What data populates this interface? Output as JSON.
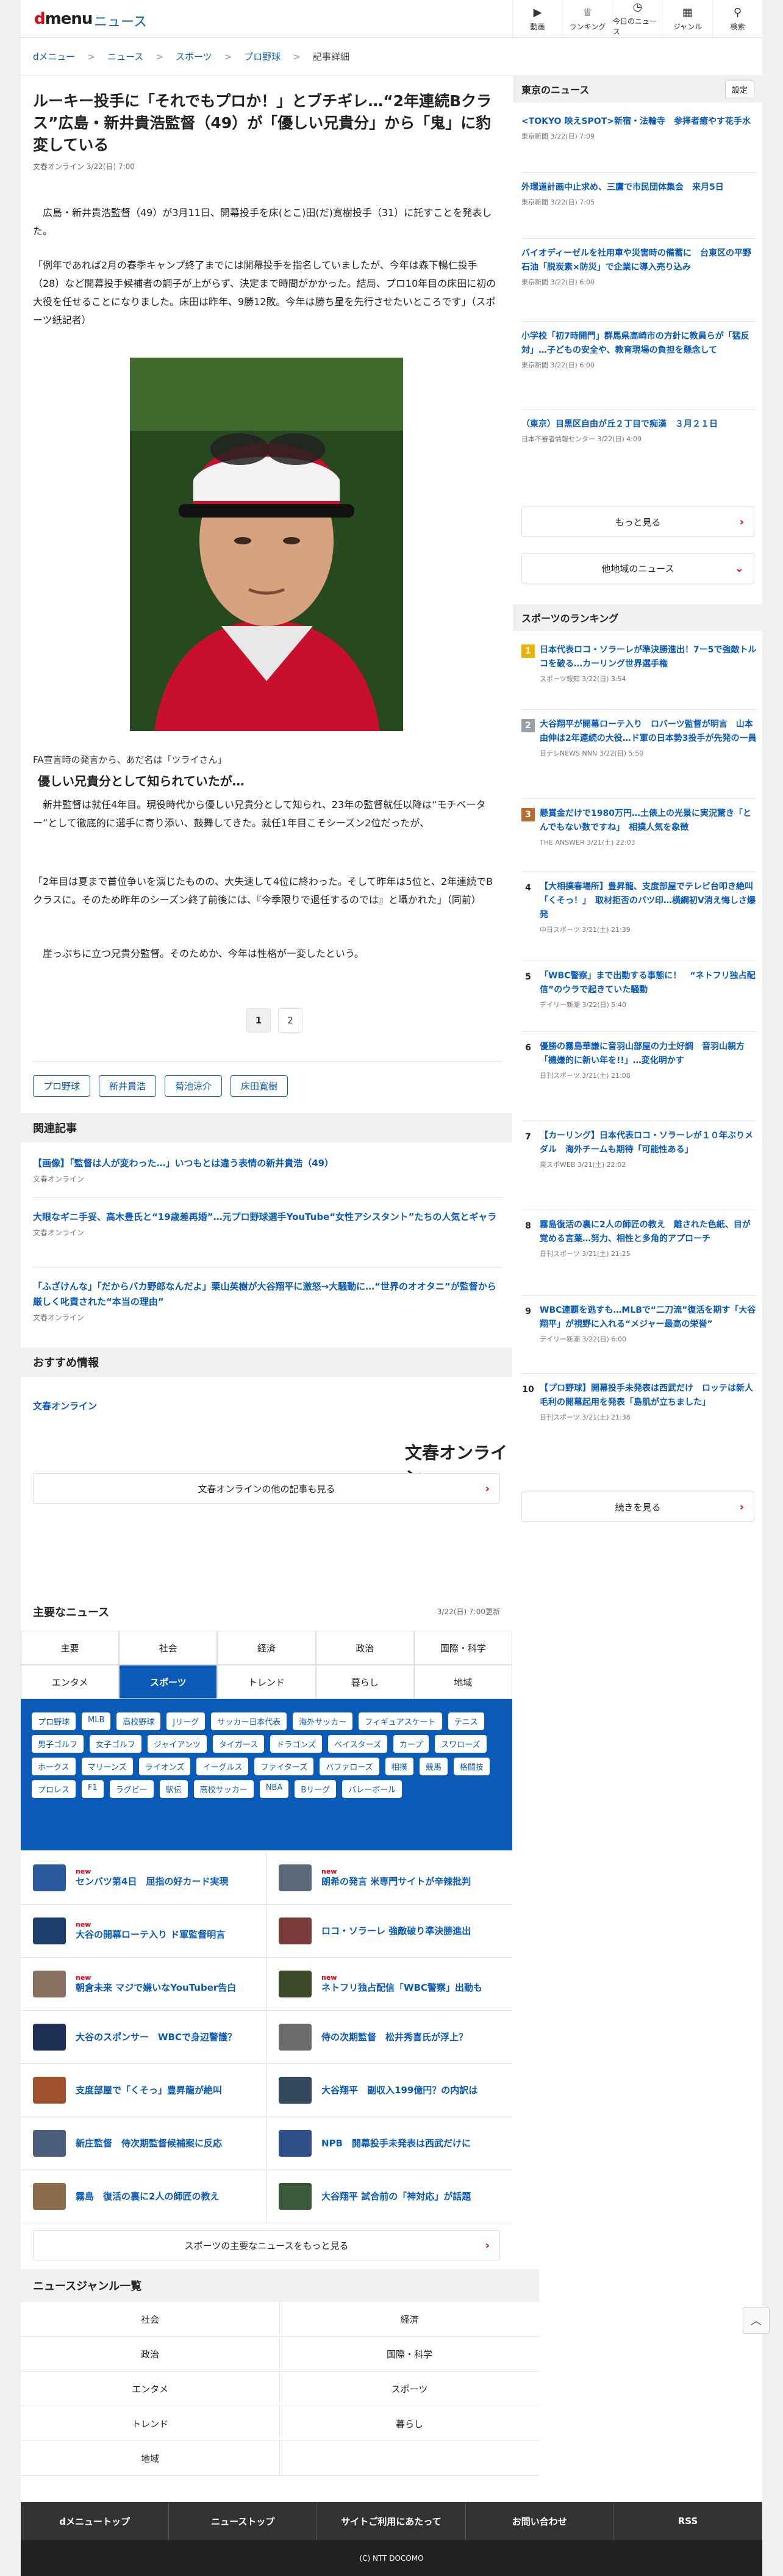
{
  "header": {
    "logo_d": "d",
    "logo_rest": "menu",
    "section": "ニュース",
    "nav": [
      {
        "icon": "▶",
        "label": "動画"
      },
      {
        "icon": "♕",
        "label": "ランキング"
      },
      {
        "icon": "◷",
        "label": "今日のニュース"
      },
      {
        "icon": "▦",
        "label": "ジャンル"
      },
      {
        "icon": "⚲",
        "label": "検索"
      }
    ]
  },
  "breadcrumb": [
    "dメニュー",
    "ニュース",
    "スポーツ",
    "プロ野球",
    "記事詳細"
  ],
  "article": {
    "title": "ルーキー投手に「それでもプロか！」とブチギレ…“2年連続Bクラス”広島・新井貴浩監督（49）が「優しい兄貴分」から「鬼」に豹変している",
    "meta": "文春オンライン 3/22(日) 7:00",
    "p1": "　広島・新井貴浩監督（49）が3月11日、開幕投手を床(とこ)田(だ)寛樹投手（31）に託すことを発表した。",
    "p2": "「例年であれば2月の春季キャンプ終了までには開幕投手を指名していましたが、今年は森下暢仁投手（28）など開幕投手候補者の調子が上がらず、決定まで時間がかかった。結局、プロ10年目の床田に初の大役を任せることになりました。床田は昨年、9勝12敗。今年は勝ち星を先行させたいところです」（スポーツ紙記者）",
    "photo_caption": "FA宣言時の発言から、あだ名は「ツライさん」",
    "subheading": "優しい兄貴分として知られていたが…",
    "p3": "　新井監督は就任4年目。現役時代から優しい兄貴分として知られ、23年の監督就任以降は“モチベーター”として徹底的に選手に寄り添い、鼓舞してきた。就任1年目こそシーズン2位だったが、",
    "p4": "「2年目は夏まで首位争いを演じたものの、大失速して4位に終わった。そして昨年は5位と、2年連続でBクラスに。そのため昨年のシーズン終了前後には、『今季限りで退任するのでは』と囁かれた」（同前）",
    "p5": "　崖っぷちに立つ兄貴分監督。そのためか、今年は性格が一変したという。",
    "pages": [
      "1",
      "2"
    ],
    "tags": [
      "プロ野球",
      "新井貴浩",
      "菊池涼介",
      "床田寛樹"
    ]
  },
  "related": {
    "heading": "関連記事",
    "items": [
      {
        "title": "【画像】「監督は人が変わった…」いつもとは違う表情の新井貴浩（49）",
        "source": "文春オンライン"
      },
      {
        "title": "大眼なギニ手妥、高木豊氏と“19歳差再婚”…元プロ野球選手YouTube“女性アシスタント”たちの人気とギャラ",
        "source": "文春オンライン"
      },
      {
        "title": "「ふざけんな」「だからバカ野郎なんだよ」栗山英樹が大谷翔平に激怒→大騒動に…“世界のオオタニ”が監督から厳しく叱責された“本当の理由”",
        "source": "文春オンライン"
      }
    ]
  },
  "recommend": {
    "heading": "おすすめ情報",
    "link": "文春オンライン",
    "logo": "文春オンライン",
    "more": "文春オンラインの他の記事も見る"
  },
  "major": {
    "heading": "主要なニュース",
    "updated": "3/22(日) 7:00更新",
    "tabs": [
      "主要",
      "社会",
      "経済",
      "政治",
      "国際・科学",
      "エンタメ",
      "スポーツ",
      "トレンド",
      "暮らし",
      "地域"
    ],
    "active_tab": "スポーツ",
    "chips": [
      "プロ野球",
      "MLB",
      "高校野球",
      "Jリーグ",
      "サッカー日本代表",
      "海外サッカー",
      "フィギュアスケート",
      "テニス",
      "男子ゴルフ",
      "女子ゴルフ",
      "ジャイアンツ",
      "タイガース",
      "ドラゴンズ",
      "ベイスターズ",
      "カープ",
      "スワローズ",
      "ホークス",
      "マリーンズ",
      "ライオンズ",
      "イーグルス",
      "ファイターズ",
      "バファローズ",
      "相撲",
      "競馬",
      "格闘技",
      "プロレス",
      "F1",
      "ラグビー",
      "駅伝",
      "高校サッカー",
      "NBA",
      "Bリーグ",
      "バレーボール"
    ],
    "items": [
      {
        "title": "センバツ第4日　屈指の好カード実現",
        "new": "new",
        "thumb": "#2b5aa0"
      },
      {
        "title": "朗希の発言 米専門サイトが辛辣批判",
        "new": "new",
        "thumb": "#5a6a7a"
      },
      {
        "title": "大谷の開幕ローテ入り ド軍監督明言",
        "new": "new",
        "thumb": "#1c3e6c"
      },
      {
        "title": "ロコ・ソラーレ 強敵破り準決勝進出",
        "new": "",
        "thumb": "#7a3b3b"
      },
      {
        "title": "朝倉未来 マジで嫌いなYouTuber告白",
        "new": "new",
        "thumb": "#8a7060"
      },
      {
        "title": "ネトフリ独占配信「WBC警察」出動も",
        "new": "new",
        "thumb": "#3c4a2a"
      },
      {
        "title": "大谷のスポンサー　WBCで身辺警護？",
        "new": "",
        "thumb": "#1e2f55"
      },
      {
        "title": "侍の次期監督　松井秀喜氏が浮上？",
        "new": "",
        "thumb": "#6b6b6b"
      },
      {
        "title": "支度部屋で「くそっ」豊昇龍が絶叫",
        "new": "",
        "thumb": "#a0522d"
      },
      {
        "title": "大谷翔平　副収入199億円？の内訳は",
        "new": "",
        "thumb": "#34495e"
      },
      {
        "title": "新庄監督　侍次期監督候補案に反応",
        "new": "",
        "thumb": "#4a5d7a"
      },
      {
        "title": "NPB　開幕投手未発表は西武だけに",
        "new": "",
        "thumb": "#2e4e8a"
      },
      {
        "title": "霧島　復活の裏に2人の師匠の教え",
        "new": "",
        "thumb": "#8b6b4a"
      },
      {
        "title": "大谷翔平 試合前の「神対応」が話題",
        "new": "",
        "thumb": "#3a5a3a"
      }
    ],
    "more": "スポーツの主要なニュースをもっと見る"
  },
  "genre": {
    "heading": "ニュースジャンル一覧",
    "items": [
      "社会",
      "経済",
      "政治",
      "国際・科学",
      "エンタメ",
      "スポーツ",
      "トレンド",
      "暮らし",
      "地域",
      ""
    ]
  },
  "footer": {
    "links": [
      "dメニュートップ",
      "ニューストップ",
      "サイトご利用にあたって",
      "お問い合わせ",
      "RSS"
    ],
    "copyright": "(C) NTT DOCOMO"
  },
  "sidebar": {
    "tokyo_heading": "東京のニュース",
    "settings": "設定",
    "tokyo": [
      {
        "title": "<TOKYO 映えSPOT>新宿・法輪寺　参拝者癒やす花手水",
        "source": "東京新聞 3/22(日) 7:09"
      },
      {
        "title": "外環道計画中止求め、三鷹で市民団体集会　来月5日",
        "source": "東京新聞 3/22(日) 7:05"
      },
      {
        "title": "バイオディーゼルを社用車や災害時の備蓄に　台東区の平野石油「脱炭素×防災」で企業に導入売り込み",
        "source": "東京新聞 3/22(日) 6:00"
      },
      {
        "title": "小学校「初7時開門」群馬県高崎市の方針に教員らが「猛反対」…子どもの安全や、教育現場の負担を懸念して",
        "source": "東京新聞 3/22(日) 6:00"
      },
      {
        "title": "（東京）目黒区自由が丘２丁目で痴漢　３月２１日",
        "source": "日本不審者情報センター 3/22(日) 4:09"
      }
    ],
    "more": "もっと見る",
    "other_region": "他地域のニュース",
    "ranking_heading": "スポーツのランキング",
    "ranking": [
      {
        "num": "1",
        "color": "#e8b400",
        "title": "日本代表ロコ・ソラーレが準決勝進出！7ー5で強敵トルコを破る…カーリング世界選手権",
        "source": "スポーツ報知 3/22(日) 3:54"
      },
      {
        "num": "2",
        "color": "#9aa0a6",
        "title": "大谷翔平が開幕ローテ入り　ロバーツ監督が明言　山本由伸は2年連続の大役…ド軍の日本勢3投手が先発の一員",
        "source": "日テレNEWS NNN 3/22(日) 5:50"
      },
      {
        "num": "3",
        "color": "#b86b2a",
        "title": "懸賞金だけで1980万円…土俵上の光景に実況驚き「とんでもない数ですね」　相撲人気を象徴",
        "source": "THE ANSWER 3/21(土) 22:03"
      },
      {
        "num": "4",
        "color": "#555555",
        "title": "【大相撲春場所】豊昇龍、支度部屋でテレビ台叩き絶叫「くそっ！」　取材拒否のバツ印…横綱初V消え悔しさ爆発",
        "source": "中日スポーツ 3/21(土) 21:39"
      },
      {
        "num": "5",
        "color": "#555555",
        "title": "「WBC警察」まで出動する事態に！　“ネトフリ独占配信”のウラで起きていた騒動",
        "source": "デイリー新潮 3/22(日) 5:40"
      },
      {
        "num": "6",
        "color": "#555555",
        "title": "優勝の霧島華謙に音羽山部屋の力士好調　音羽山親方「機嫌的に新い年を!!」…変化明かす",
        "source": "日刊スポーツ 3/21(土) 21:08"
      },
      {
        "num": "7",
        "color": "#555555",
        "title": "【カーリング】日本代表ロコ・ソラーレが１０年ぶりメダル　海外チームも期待「可能性ある」",
        "source": "東スポWEB 3/21(土) 22:02"
      },
      {
        "num": "8",
        "color": "#555555",
        "title": "霧島復活の裏に2人の師匠の教え　離された色紙、目が覚める言葉…努力、相性と多角的アプローチ",
        "source": "日刊スポーツ 3/21(土) 21:25"
      },
      {
        "num": "9",
        "color": "#555555",
        "title": "WBC連覇を逃すも…MLBで“二刀流”復活を期す「大谷翔平」が視野に入れる“メジャー最高の栄誉”",
        "source": "デイリー新潮 3/22(日) 6:00"
      },
      {
        "num": "10",
        "color": "#555555",
        "title": "【プロ野球】開幕投手未発表は西武だけ　ロッテは新人毛利の開幕起用を発表「島肌が立ちました」",
        "source": "日刊スポーツ 3/21(土) 21:38"
      }
    ],
    "ranking_more": "続きを見る"
  }
}
